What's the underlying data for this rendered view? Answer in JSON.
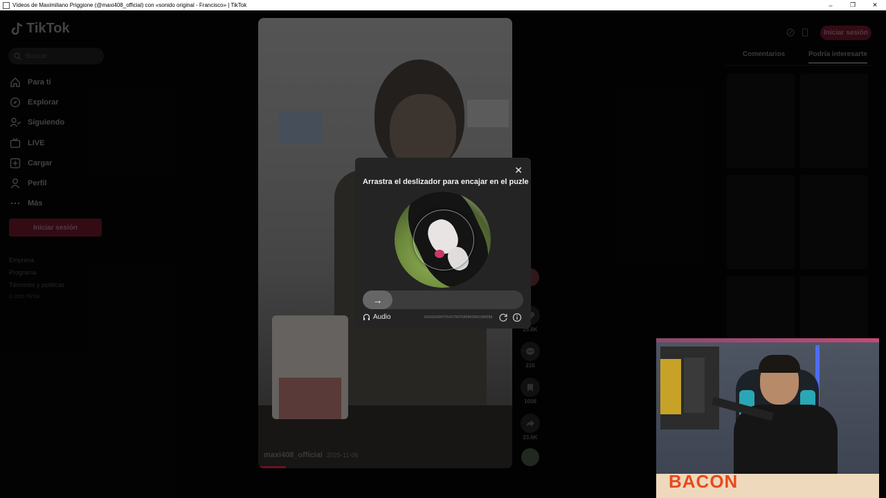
{
  "window": {
    "title": "Vídeos de Maximiliano Priggione (@maxi408_official) con «sonido original - Francisco» | TikTok",
    "minimize": "–",
    "restore": "❐",
    "close": "✕"
  },
  "sidebar": {
    "logo": "TikTok",
    "search_placeholder": "Buscar",
    "items": [
      {
        "label": "Para ti",
        "icon": "home-icon"
      },
      {
        "label": "Explorar",
        "icon": "compass-icon"
      },
      {
        "label": "Siguiendo",
        "icon": "following-icon"
      },
      {
        "label": "LIVE",
        "icon": "live-icon"
      },
      {
        "label": "Cargar",
        "icon": "upload-icon"
      },
      {
        "label": "Perfil",
        "icon": "profile-icon"
      },
      {
        "label": "Más",
        "icon": "more-icon"
      }
    ],
    "login_button": "Iniciar sesión",
    "footer": [
      "Empresa",
      "Programa",
      "Términos y políticas"
    ],
    "copyright": "© 2026 TikTok"
  },
  "video": {
    "author": "maxi408_official",
    "date": "2025-11-06"
  },
  "actions": {
    "likes": "25.8K",
    "comments": "216",
    "saves": "1008",
    "shares": "23.6K"
  },
  "header": {
    "login_button": "Iniciar sesión"
  },
  "right_panel": {
    "tabs": [
      "Comentarios",
      "Podría interesarte"
    ],
    "active_tab": "Podría interesarte"
  },
  "captcha": {
    "title": "Arrastra el deslizador para encajar en el puzle",
    "close": "✕",
    "slider_arrow": "→",
    "audio_label": "Audio",
    "code": "2026020907554S7997589905965380088"
  },
  "overlay": {
    "banner_text": "BACON"
  },
  "colors": {
    "brand": "#fe2c55",
    "captcha_bg": "#242424"
  }
}
